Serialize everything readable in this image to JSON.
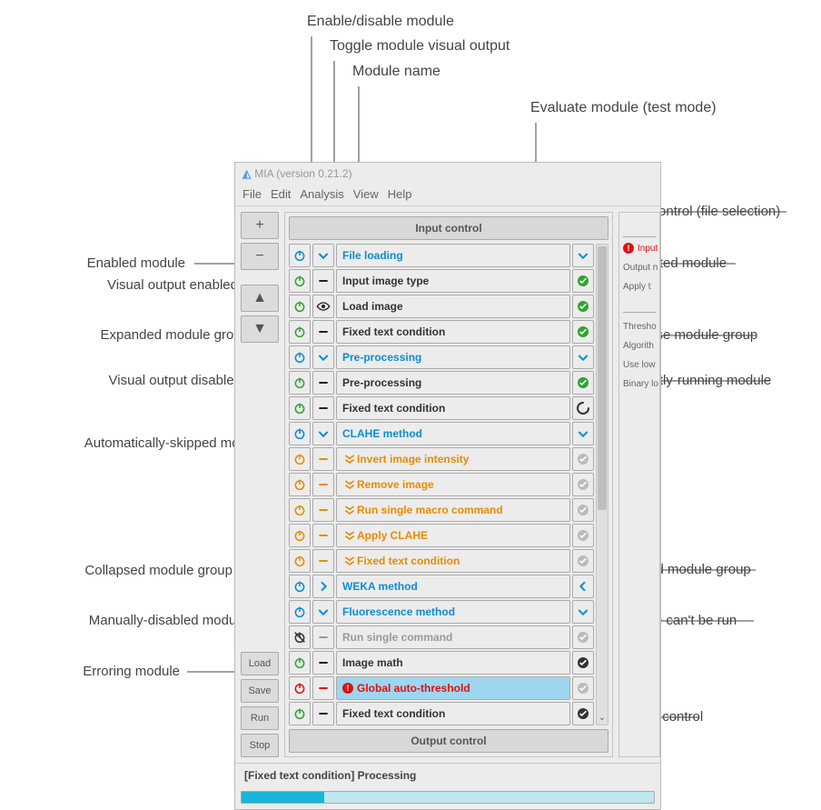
{
  "app": {
    "title": "MIA (version 0.21.2)",
    "menus": [
      "File",
      "Edit",
      "Analysis",
      "View",
      "Help"
    ],
    "sidebar": {
      "add": "+",
      "remove": "−",
      "up": "▲",
      "down": "▼",
      "load": "Load",
      "save": "Save",
      "run": "Run",
      "stop": "Stop"
    },
    "header_input": "Input control",
    "header_output": "Output control",
    "status": "[Fixed text condition] Processing",
    "progress_pct": 20,
    "right_panel": {
      "warn": "Input",
      "lines": [
        "Output n",
        "Apply t",
        "Thresho",
        "Algorith",
        "Use low",
        "Binary lo"
      ]
    },
    "modules": [
      {
        "name": "File loading",
        "kind": "group",
        "power": "blue",
        "visual": "chev-down-blue",
        "eval": "chev-down-blue"
      },
      {
        "name": "Input image type",
        "kind": "normal",
        "power": "green",
        "visual": "dash",
        "eval": "ok-green"
      },
      {
        "name": "Load image",
        "kind": "normal",
        "power": "green",
        "visual": "eye",
        "eval": "ok-green"
      },
      {
        "name": "Fixed text condition",
        "kind": "normal",
        "power": "green",
        "visual": "dash",
        "eval": "ok-green"
      },
      {
        "name": "Pre-processing",
        "kind": "group",
        "power": "blue",
        "visual": "chev-down-blue",
        "eval": "chev-down-blue"
      },
      {
        "name": "Pre-processing",
        "kind": "normal",
        "power": "green",
        "visual": "dash",
        "eval": "ok-green"
      },
      {
        "name": "Fixed text condition",
        "kind": "normal",
        "power": "green",
        "visual": "dash",
        "eval": "spinner"
      },
      {
        "name": "CLAHE method",
        "kind": "group",
        "power": "blue",
        "visual": "chev-down-blue",
        "eval": "chev-down-blue"
      },
      {
        "name": "Invert image intensity",
        "kind": "skipped",
        "power": "orange",
        "visual": "skip",
        "eval": "tick-dim"
      },
      {
        "name": "Remove image",
        "kind": "skipped",
        "power": "orange",
        "visual": "skip",
        "eval": "tick-dim"
      },
      {
        "name": "Run single macro command",
        "kind": "skipped",
        "power": "orange",
        "visual": "skip",
        "eval": "tick-dim"
      },
      {
        "name": "Apply CLAHE",
        "kind": "skipped",
        "power": "orange",
        "visual": "skip",
        "eval": "tick-dim"
      },
      {
        "name": "Fixed text condition",
        "kind": "skipped",
        "power": "orange",
        "visual": "skip",
        "eval": "tick-dim"
      },
      {
        "name": "WEKA method",
        "kind": "group",
        "power": "blue",
        "visual": "chev-right-blue",
        "eval": "chev-left-blue"
      },
      {
        "name": "Fluorescence method",
        "kind": "group",
        "power": "blue",
        "visual": "chev-down-blue",
        "eval": "chev-down-blue"
      },
      {
        "name": "Run single command",
        "kind": "disabled",
        "power": "off",
        "visual": "dash-dim",
        "eval": "tick-dim"
      },
      {
        "name": "Image math",
        "kind": "normal",
        "power": "green",
        "visual": "dash",
        "eval": "tick-black"
      },
      {
        "name": "Global auto-threshold",
        "kind": "error",
        "power": "red",
        "visual": "dash-red",
        "eval": "tick-dim",
        "warn": true,
        "selected": true
      },
      {
        "name": "Fixed text condition",
        "kind": "normal",
        "power": "green",
        "visual": "dash",
        "eval": "tick-black"
      }
    ]
  },
  "callouts": {
    "top1": "Enable/disable module",
    "top2": "Toggle module visual output",
    "top3": "Module name",
    "top4": "Evaluate module (test mode)",
    "l_enabled": "Enabled module",
    "l_visout_on": "Visual output enabled",
    "l_expanded": "Expanded module group",
    "l_visout_off": "Visual output disabled",
    "l_autoskip": "Automatically-skipped module",
    "l_collapsed": "Collapsed module group",
    "l_manual_off": "Manually-disabled module",
    "l_error": "Erroring module",
    "r_input": "Input control (file selection)",
    "r_evaluated": "Evaluated module",
    "r_collapse": "Collapse module group",
    "r_running": "Currently-running module",
    "r_expand": "Expand module group",
    "r_cantrun": "Module can't be run",
    "r_output": "Output control"
  }
}
